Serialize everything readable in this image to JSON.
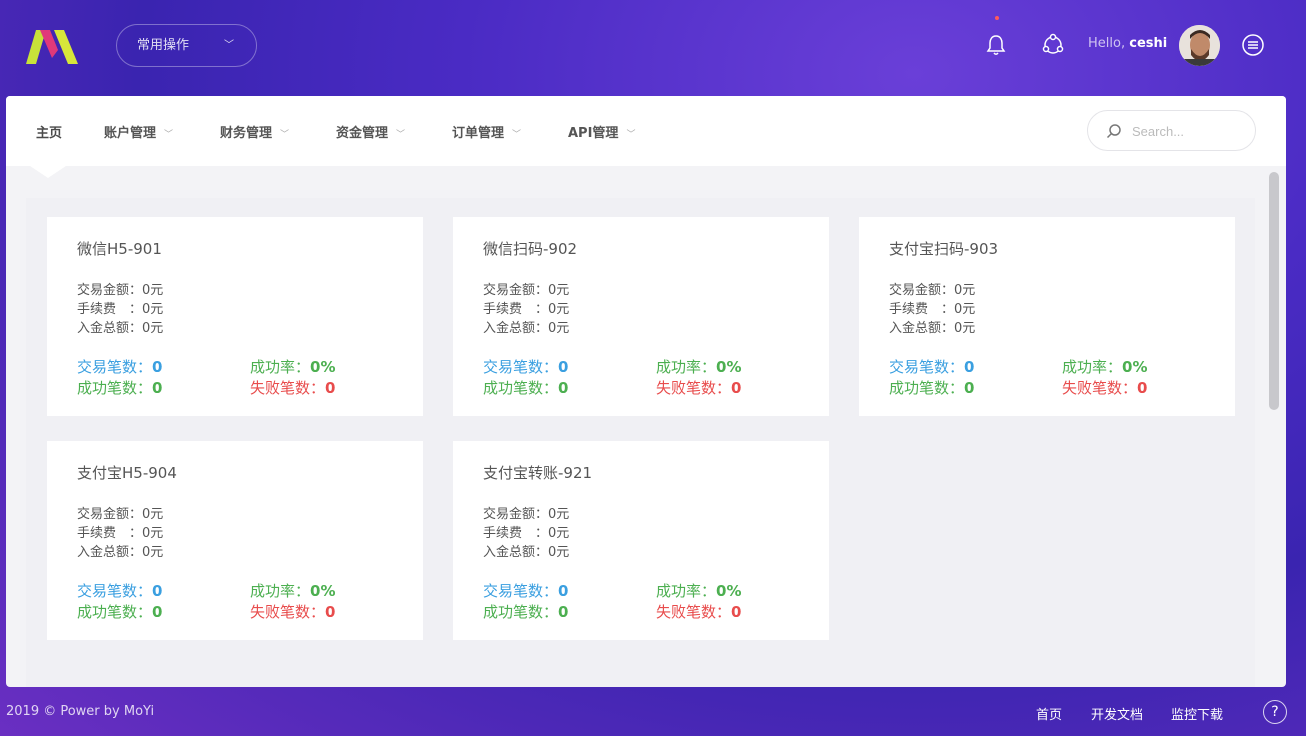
{
  "header": {
    "quick_ops_label": "常用操作",
    "hello_prefix": "Hello,",
    "username": "ceshi",
    "icons": [
      "bell-icon",
      "network-icon",
      "menu-icon"
    ]
  },
  "nav": {
    "items": [
      {
        "label": "主页",
        "active": true
      },
      {
        "label": "账户管理"
      },
      {
        "label": "财务管理"
      },
      {
        "label": "资金管理"
      },
      {
        "label": "订单管理"
      },
      {
        "label": "API管理"
      }
    ],
    "search_placeholder": "Search..."
  },
  "labels": {
    "amount": "交易金额：",
    "fee": "手续费　：",
    "income": "入金总额：",
    "tx_count": "交易笔数：",
    "success_rate": "成功率：",
    "success_count": "成功笔数：",
    "fail_count": "失败笔数："
  },
  "cards": [
    {
      "title": "微信H5-901",
      "amount": "0元",
      "fee": "0元",
      "income": "0元",
      "tx_count": "0",
      "success_rate": "0%",
      "success_count": "0",
      "fail_count": "0"
    },
    {
      "title": "微信扫码-902",
      "amount": "0元",
      "fee": "0元",
      "income": "0元",
      "tx_count": "0",
      "success_rate": "0%",
      "success_count": "0",
      "fail_count": "0"
    },
    {
      "title": "支付宝扫码-903",
      "amount": "0元",
      "fee": "0元",
      "income": "0元",
      "tx_count": "0",
      "success_rate": "0%",
      "success_count": "0",
      "fail_count": "0"
    },
    {
      "title": "支付宝H5-904",
      "amount": "0元",
      "fee": "0元",
      "income": "0元",
      "tx_count": "0",
      "success_rate": "0%",
      "success_count": "0",
      "fail_count": "0"
    },
    {
      "title": "支付宝转账-921",
      "amount": "0元",
      "fee": "0元",
      "income": "0元",
      "tx_count": "0",
      "success_rate": "0%",
      "success_count": "0",
      "fail_count": "0"
    }
  ],
  "footer": {
    "copyright": "2019 © Power by MoYi",
    "links": [
      "首页",
      "开发文档",
      "监控下载"
    ],
    "help_label": "?"
  },
  "colors": {
    "blue": "#3a9fe0",
    "green": "#4caf50",
    "red": "#e84c4c",
    "logo_yellow": "#d7e63a",
    "logo_pink": "#e0397a"
  }
}
